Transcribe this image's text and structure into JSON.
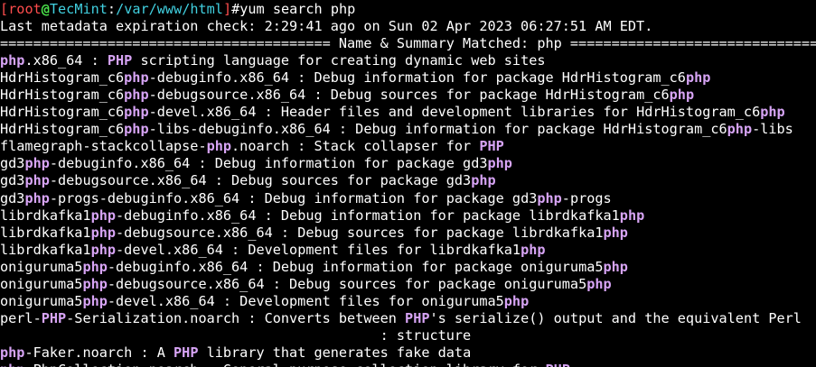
{
  "colors": {
    "background": "#000000",
    "text": "#ffffff",
    "highlight": "#d7a4f5",
    "prompt_bracket": "#ff4d4d",
    "prompt_user": "#4be24b",
    "prompt_path": "#41d0e0"
  },
  "prompt": {
    "open_bracket": "[",
    "user": "root",
    "at": "@",
    "host": "TecMint",
    "colon": ":",
    "path": "/var/www/html",
    "close_bracket": "]",
    "symbol": "#",
    "command": "yum search php"
  },
  "output_lines": [
    {
      "segments": [
        {
          "t": "Last metadata expiration check: 2:29:41 ago on Sun 02 Apr 2023 06:27:51 AM EDT.",
          "h": false
        }
      ]
    },
    {
      "segments": [
        {
          "t": "======================================== Name & Summary Matched: php ========================================",
          "h": false
        }
      ]
    },
    {
      "segments": [
        {
          "t": "php",
          "h": true
        },
        {
          "t": ".x86_64 : ",
          "h": false
        },
        {
          "t": "PHP",
          "h": true
        },
        {
          "t": " scripting language for creating dynamic web sites",
          "h": false
        }
      ]
    },
    {
      "segments": [
        {
          "t": "HdrHistogram_c6",
          "h": false
        },
        {
          "t": "php",
          "h": true
        },
        {
          "t": "-debuginfo.x86_64 : Debug information for package HdrHistogram_c6",
          "h": false
        },
        {
          "t": "php",
          "h": true
        }
      ]
    },
    {
      "segments": [
        {
          "t": "HdrHistogram_c6",
          "h": false
        },
        {
          "t": "php",
          "h": true
        },
        {
          "t": "-debugsource.x86_64 : Debug sources for package HdrHistogram_c6",
          "h": false
        },
        {
          "t": "php",
          "h": true
        }
      ]
    },
    {
      "segments": [
        {
          "t": "HdrHistogram_c6",
          "h": false
        },
        {
          "t": "php",
          "h": true
        },
        {
          "t": "-devel.x86_64 : Header files and development libraries for HdrHistogram_c6",
          "h": false
        },
        {
          "t": "php",
          "h": true
        }
      ]
    },
    {
      "segments": [
        {
          "t": "HdrHistogram_c6",
          "h": false
        },
        {
          "t": "php",
          "h": true
        },
        {
          "t": "-libs-debuginfo.x86_64 : Debug information for package HdrHistogram_c6",
          "h": false
        },
        {
          "t": "php",
          "h": true
        },
        {
          "t": "-libs",
          "h": false
        }
      ]
    },
    {
      "segments": [
        {
          "t": "flamegraph-stackcollapse-",
          "h": false
        },
        {
          "t": "php",
          "h": true
        },
        {
          "t": ".noarch : Stack collapser for ",
          "h": false
        },
        {
          "t": "PHP",
          "h": true
        }
      ]
    },
    {
      "segments": [
        {
          "t": "gd3",
          "h": false
        },
        {
          "t": "php",
          "h": true
        },
        {
          "t": "-debuginfo.x86_64 : Debug information for package gd3",
          "h": false
        },
        {
          "t": "php",
          "h": true
        }
      ]
    },
    {
      "segments": [
        {
          "t": "gd3",
          "h": false
        },
        {
          "t": "php",
          "h": true
        },
        {
          "t": "-debugsource.x86_64 : Debug sources for package gd3",
          "h": false
        },
        {
          "t": "php",
          "h": true
        }
      ]
    },
    {
      "segments": [
        {
          "t": "gd3",
          "h": false
        },
        {
          "t": "php",
          "h": true
        },
        {
          "t": "-progs-debuginfo.x86_64 : Debug information for package gd3",
          "h": false
        },
        {
          "t": "php",
          "h": true
        },
        {
          "t": "-progs",
          "h": false
        }
      ]
    },
    {
      "segments": [
        {
          "t": "librdkafka1",
          "h": false
        },
        {
          "t": "php",
          "h": true
        },
        {
          "t": "-debuginfo.x86_64 : Debug information for package librdkafka1",
          "h": false
        },
        {
          "t": "php",
          "h": true
        }
      ]
    },
    {
      "segments": [
        {
          "t": "librdkafka1",
          "h": false
        },
        {
          "t": "php",
          "h": true
        },
        {
          "t": "-debugsource.x86_64 : Debug sources for package librdkafka1",
          "h": false
        },
        {
          "t": "php",
          "h": true
        }
      ]
    },
    {
      "segments": [
        {
          "t": "librdkafka1",
          "h": false
        },
        {
          "t": "php",
          "h": true
        },
        {
          "t": "-devel.x86_64 : Development files for librdkafka1",
          "h": false
        },
        {
          "t": "php",
          "h": true
        }
      ]
    },
    {
      "segments": [
        {
          "t": "oniguruma5",
          "h": false
        },
        {
          "t": "php",
          "h": true
        },
        {
          "t": "-debuginfo.x86_64 : Debug information for package oniguruma5",
          "h": false
        },
        {
          "t": "php",
          "h": true
        }
      ]
    },
    {
      "segments": [
        {
          "t": "oniguruma5",
          "h": false
        },
        {
          "t": "php",
          "h": true
        },
        {
          "t": "-debugsource.x86_64 : Debug sources for package oniguruma5",
          "h": false
        },
        {
          "t": "php",
          "h": true
        }
      ]
    },
    {
      "segments": [
        {
          "t": "oniguruma5",
          "h": false
        },
        {
          "t": "php",
          "h": true
        },
        {
          "t": "-devel.x86_64 : Development files for oniguruma5",
          "h": false
        },
        {
          "t": "php",
          "h": true
        }
      ]
    },
    {
      "segments": [
        {
          "t": "perl-",
          "h": false
        },
        {
          "t": "PHP",
          "h": true
        },
        {
          "t": "-Serialization.noarch : Converts between ",
          "h": false
        },
        {
          "t": "PHP",
          "h": true
        },
        {
          "t": "'s serialize() output and the equivalent Perl",
          "h": false
        }
      ]
    },
    {
      "segments": [
        {
          "t": "                                              : structure",
          "h": false
        }
      ]
    },
    {
      "segments": [
        {
          "t": "php",
          "h": true
        },
        {
          "t": "-Faker.noarch : A ",
          "h": false
        },
        {
          "t": "PHP",
          "h": true
        },
        {
          "t": " library that generates fake data",
          "h": false
        }
      ]
    },
    {
      "segments": [
        {
          "t": "php",
          "h": true
        },
        {
          "t": "-PhpCollection.noarch : General purpose collection library for ",
          "h": false
        },
        {
          "t": "PHP",
          "h": true
        }
      ]
    }
  ]
}
